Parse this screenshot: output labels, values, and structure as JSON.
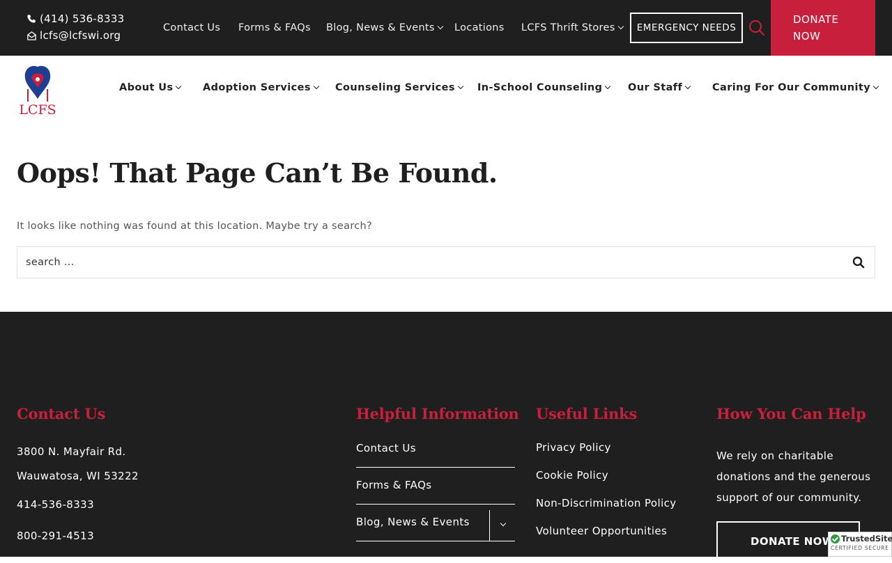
{
  "topbar": {
    "phone": "(414) 536-8333",
    "email": "lcfs@lcfswi.org",
    "nav": [
      {
        "label": "Contact Us",
        "has_dropdown": false
      },
      {
        "label": "Forms & FAQs",
        "has_dropdown": false
      },
      {
        "label": "Blog, News & Events",
        "has_dropdown": true
      },
      {
        "label": "Locations",
        "has_dropdown": false
      },
      {
        "label": "LCFS Thrift Stores",
        "has_dropdown": true
      }
    ],
    "emergency_label": "EMERGENCY NEEDS",
    "search_icon": "search-icon",
    "donate_line1": "DONATE",
    "donate_line2": "NOW"
  },
  "logo": {
    "text": "LCFS"
  },
  "mainnav": [
    {
      "label": "About Us"
    },
    {
      "label": "Adoption Services"
    },
    {
      "label": "Counseling Services"
    },
    {
      "label": "In-School Counseling"
    },
    {
      "label": "Our Staff"
    },
    {
      "label": "Caring For Our Community"
    }
  ],
  "content": {
    "title": "Oops! That Page Can’t Be Found.",
    "lead": "It looks like nothing was found at this location. Maybe try a search?",
    "search_placeholder": "search ...",
    "search_button_icon": "search-icon"
  },
  "footer": {
    "contact": {
      "title": "Contact Us",
      "address1": "3800 N. Mayfair Rd.",
      "address2": "Wauwatosa, WI 53222",
      "phone1": "414-536-8333",
      "phone2": "800-291-4513"
    },
    "helpful": {
      "title": "Helpful Information",
      "links": [
        "Contact Us",
        "Forms & FAQs",
        "Blog, News & Events"
      ]
    },
    "useful": {
      "title": "Useful Links",
      "links": [
        "Privacy Policy",
        "Cookie Policy",
        "Non-Discrimination Policy",
        "Volunteer Opportunities"
      ]
    },
    "help": {
      "title": "How You Can Help",
      "text": "We rely on charitable donations and the generous support of our community.",
      "donate_label": "DONATE NOW"
    }
  },
  "badge": {
    "name": "TrustedSite",
    "sub": "CERTIFIED SECURE"
  },
  "colors": {
    "brand_red": "#c8203c",
    "dark": "#1f1f1f",
    "logo_blue": "#1c3f94"
  }
}
